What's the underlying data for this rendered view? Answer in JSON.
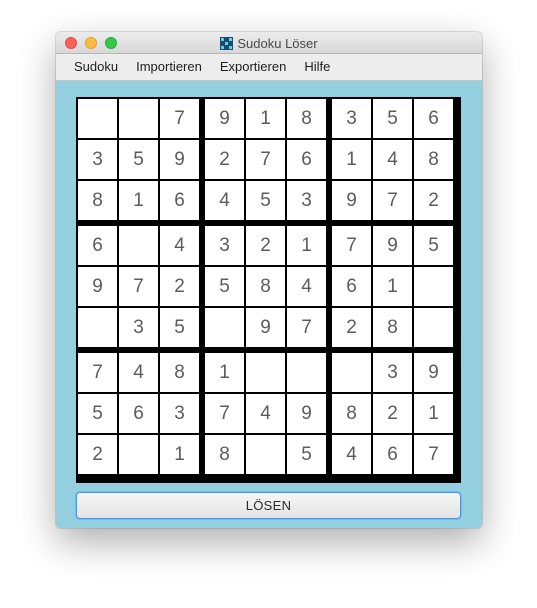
{
  "window": {
    "title": "Sudoku Löser"
  },
  "menu": {
    "items": [
      "Sudoku",
      "Importieren",
      "Exportieren",
      "Hilfe"
    ]
  },
  "board": {
    "rows": [
      [
        "",
        "",
        "7",
        "9",
        "1",
        "8",
        "3",
        "5",
        "6"
      ],
      [
        "3",
        "5",
        "9",
        "2",
        "7",
        "6",
        "1",
        "4",
        "8"
      ],
      [
        "8",
        "1",
        "6",
        "4",
        "5",
        "3",
        "9",
        "7",
        "2"
      ],
      [
        "6",
        "",
        "4",
        "3",
        "2",
        "1",
        "7",
        "9",
        "5"
      ],
      [
        "9",
        "7",
        "2",
        "5",
        "8",
        "4",
        "6",
        "1",
        ""
      ],
      [
        "",
        "3",
        "5",
        "",
        "9",
        "7",
        "2",
        "8",
        ""
      ],
      [
        "7",
        "4",
        "8",
        "1",
        "",
        "",
        "",
        "3",
        "9"
      ],
      [
        "5",
        "6",
        "3",
        "7",
        "4",
        "9",
        "8",
        "2",
        "1"
      ],
      [
        "2",
        "",
        "1",
        "8",
        "",
        "5",
        "4",
        "6",
        "7"
      ]
    ]
  },
  "solve_button": {
    "label": "LÖSEN"
  },
  "colors": {
    "background": "#94cfdf",
    "grid": "#000000",
    "digit": "#5c5c5c",
    "focus": "#3b99fc"
  }
}
